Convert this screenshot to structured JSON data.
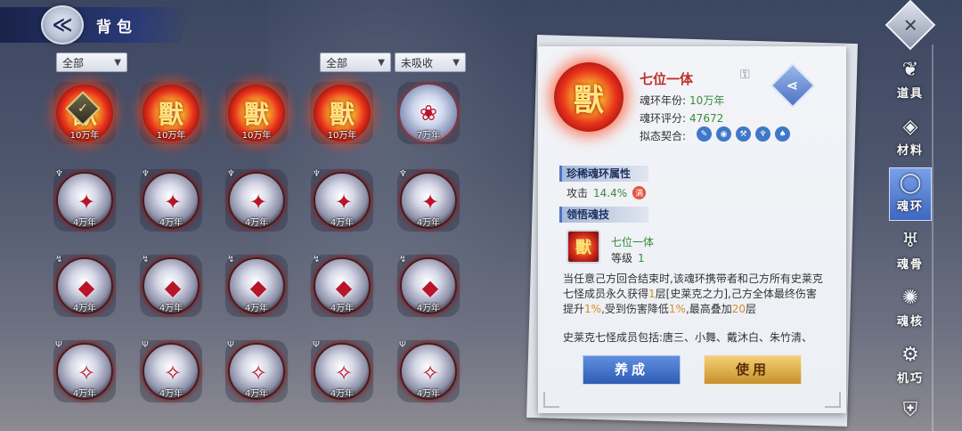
{
  "header": {
    "title": "背包",
    "back_icon": "swirl-back-icon"
  },
  "filters": {
    "left_category": "全部",
    "right_category": "全部",
    "absorb_status": "未吸收"
  },
  "rings": [
    {
      "age": "10万年",
      "style": "red",
      "glyph": "獸",
      "equipped": true,
      "badge": ""
    },
    {
      "age": "10万年",
      "style": "red",
      "glyph": "獸",
      "equipped": false,
      "badge": ""
    },
    {
      "age": "10万年",
      "style": "red",
      "glyph": "獸",
      "equipped": false,
      "badge": ""
    },
    {
      "age": "10万年",
      "style": "red",
      "glyph": "獸",
      "equipped": false,
      "badge": ""
    },
    {
      "age": "7万年",
      "style": "blue",
      "glyph": "❀",
      "equipped": false,
      "badge": ""
    },
    {
      "age": "4万年",
      "style": "silver",
      "glyph": "✦",
      "equipped": false,
      "badge": "♆"
    },
    {
      "age": "4万年",
      "style": "silver",
      "glyph": "✦",
      "equipped": false,
      "badge": "♆"
    },
    {
      "age": "4万年",
      "style": "silver",
      "glyph": "✦",
      "equipped": false,
      "badge": "♆"
    },
    {
      "age": "4万年",
      "style": "silver",
      "glyph": "✦",
      "equipped": false,
      "badge": "♆"
    },
    {
      "age": "4万年",
      "style": "silver",
      "glyph": "✦",
      "equipped": false,
      "badge": "♆"
    },
    {
      "age": "4万年",
      "style": "silver",
      "glyph": "◆",
      "equipped": false,
      "badge": "↯"
    },
    {
      "age": "4万年",
      "style": "silver",
      "glyph": "◆",
      "equipped": false,
      "badge": "↯"
    },
    {
      "age": "4万年",
      "style": "silver",
      "glyph": "◆",
      "equipped": false,
      "badge": "↯"
    },
    {
      "age": "4万年",
      "style": "silver",
      "glyph": "◆",
      "equipped": false,
      "badge": "↯"
    },
    {
      "age": "4万年",
      "style": "silver",
      "glyph": "◆",
      "equipped": false,
      "badge": "↯"
    },
    {
      "age": "4万年",
      "style": "silver",
      "glyph": "✧",
      "equipped": false,
      "badge": "Ψ"
    },
    {
      "age": "4万年",
      "style": "silver",
      "glyph": "✧",
      "equipped": false,
      "badge": "Ψ"
    },
    {
      "age": "4万年",
      "style": "silver",
      "glyph": "✧",
      "equipped": false,
      "badge": "Ψ"
    },
    {
      "age": "4万年",
      "style": "silver",
      "glyph": "✧",
      "equipped": false,
      "badge": "Ψ"
    },
    {
      "age": "4万年",
      "style": "silver",
      "glyph": "✧",
      "equipped": false,
      "badge": "Ψ"
    }
  ],
  "detail": {
    "name": "七位一体",
    "year_label": "魂环年份:",
    "year_value": "10万年",
    "score_label": "魂环评分:",
    "score_value": "47672",
    "fit_label": "拟态契合:",
    "fit_icons": [
      "✎",
      "◉",
      "⚒",
      "♆",
      "♠"
    ],
    "rare_attr_heading": "珍稀魂环属性",
    "attr_name": "攻击",
    "attr_value": "14.4%",
    "attr_max_badge": "满",
    "skill_heading": "领悟魂技",
    "skill_name": "七位一体",
    "skill_level_label": "等级",
    "skill_level": "1",
    "desc_part1": "当任意己方回合结束时,该魂环携带者和己方所有史莱克七怪成员永久获得",
    "desc_hl1": "1",
    "desc_part2": "层[史莱克之力],己方全体最终伤害提升",
    "desc_hl2": "1%",
    "desc_part3": ",受到伤害降低",
    "desc_hl3": "1%",
    "desc_part4": ",最高叠加",
    "desc_hl4": "20",
    "desc_part5": "层",
    "members": "史莱克七怪成员包括:唐三、小舞、戴沐白、朱竹清、",
    "cultivate_label": "养成",
    "use_label": "使用"
  },
  "nav": [
    {
      "label": "道具",
      "icon": "feather-icon",
      "glyph": "❦",
      "active": false
    },
    {
      "label": "材料",
      "icon": "crystal-icon",
      "glyph": "◈",
      "active": false
    },
    {
      "label": "魂环",
      "icon": "ring-icon",
      "glyph": "◯",
      "active": true
    },
    {
      "label": "魂骨",
      "icon": "bone-icon",
      "glyph": "♅",
      "active": false
    },
    {
      "label": "魂核",
      "icon": "core-icon",
      "glyph": "✺",
      "active": false
    },
    {
      "label": "机巧",
      "icon": "gear-wing-icon",
      "glyph": "⚙",
      "active": false
    },
    {
      "label": "",
      "icon": "armor-icon",
      "glyph": "⛨",
      "active": false
    }
  ],
  "colors": {
    "accent_blue": "#3d67c0",
    "accent_gold": "#c7902c",
    "highlight_green": "#3a8a3a",
    "title_red": "#c0302a"
  }
}
